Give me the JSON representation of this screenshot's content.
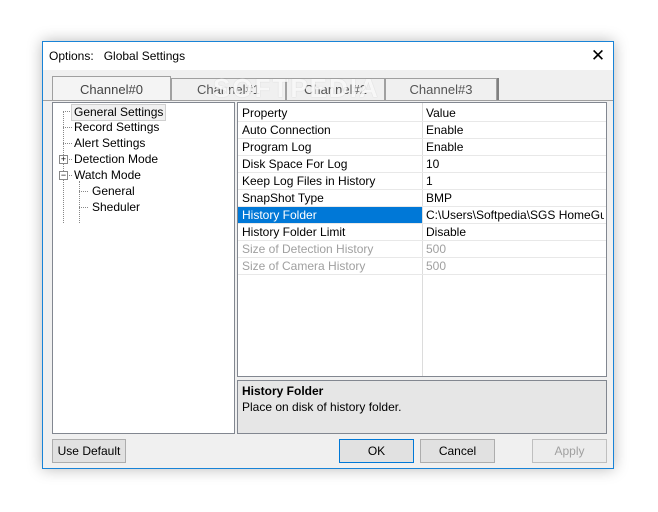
{
  "window": {
    "title": "Options:   Global Settings",
    "close_glyph": "✕"
  },
  "watermark": "SOFTPEDIA",
  "tabs": [
    {
      "label": "Channel#0",
      "active": true
    },
    {
      "label": "Channel#1",
      "active": false
    },
    {
      "label": "Channel#2",
      "active": false
    },
    {
      "label": "Channel#3",
      "active": false
    }
  ],
  "tree": {
    "items": [
      {
        "label": "General Settings",
        "selected": true
      },
      {
        "label": "Record Settings"
      },
      {
        "label": "Alert Settings"
      },
      {
        "label": "Detection Mode",
        "expander": "+"
      },
      {
        "label": "Watch Mode",
        "expander": "−"
      },
      {
        "label": "General"
      },
      {
        "label": "Sheduler"
      }
    ]
  },
  "grid": {
    "header": {
      "name": "Property",
      "value": "Value"
    },
    "rows": [
      {
        "name": "Auto Connection",
        "value": "Enable"
      },
      {
        "name": "Program Log",
        "value": "Enable"
      },
      {
        "name": "Disk Space For Log",
        "value": "10"
      },
      {
        "name": "Keep Log Files in History",
        "value": "1"
      },
      {
        "name": "SnapShot Type",
        "value": "BMP"
      },
      {
        "name": "History Folder",
        "value": "C:\\Users\\Softpedia\\SGS HomeGuar...",
        "selected": true
      },
      {
        "name": "History Folder Limit",
        "value": "Disable"
      },
      {
        "name": "Size of Detection History",
        "value": "500",
        "disabled": true
      },
      {
        "name": "Size of Camera History",
        "value": "500",
        "disabled": true
      }
    ]
  },
  "description": {
    "title": "History Folder",
    "text": "Place on disk of history folder."
  },
  "buttons": {
    "use_default": "Use Default",
    "ok": "OK",
    "cancel": "Cancel",
    "apply": "Apply"
  },
  "colors": {
    "selection": "#0078d7",
    "window_border": "#1883d7"
  }
}
